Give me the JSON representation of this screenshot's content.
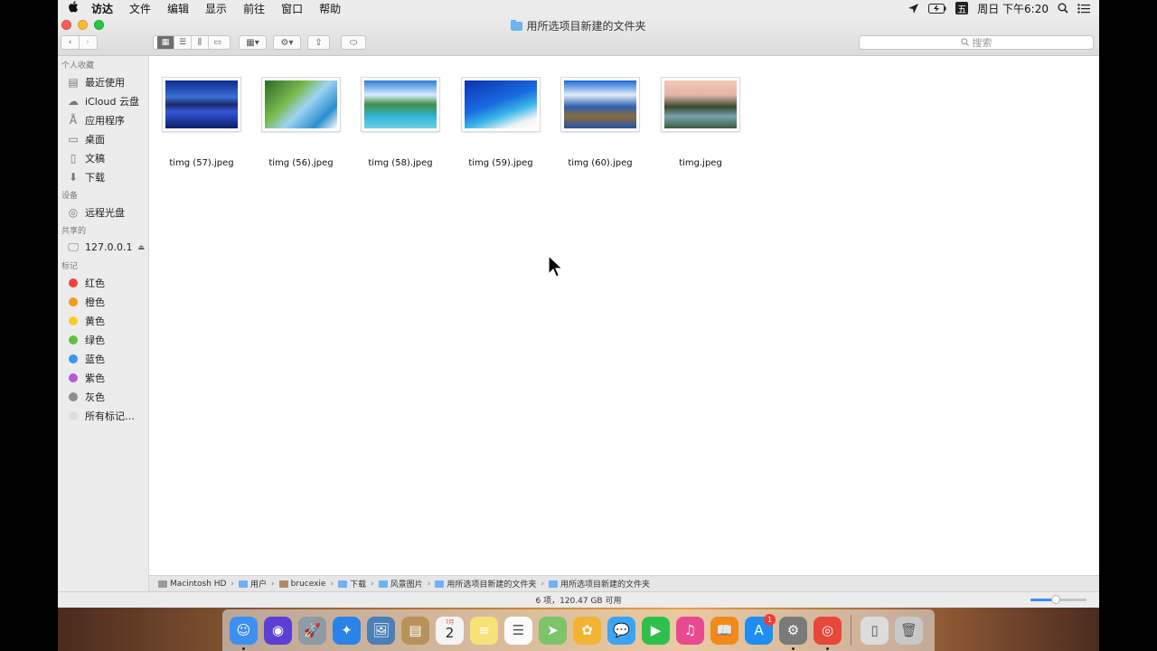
{
  "menubar": {
    "apple_icon": "apple-icon",
    "items": [
      "访达",
      "文件",
      "编辑",
      "显示",
      "前往",
      "窗口",
      "帮助"
    ],
    "ime_label": "五",
    "clock": "周日 下午6:20"
  },
  "window": {
    "title": "用所选项目新建的文件夹",
    "search_placeholder": "搜索"
  },
  "sidebar": {
    "sections": {
      "favorites": "个人收藏",
      "devices": "设备",
      "shared": "共享的",
      "tags": "标记"
    },
    "favorites": [
      {
        "label": "最近使用",
        "icon": "clock-doc-icon"
      },
      {
        "label": "iCloud 云盘",
        "icon": "cloud-icon"
      },
      {
        "label": "应用程序",
        "icon": "applications-icon"
      },
      {
        "label": "桌面",
        "icon": "desktop-icon"
      },
      {
        "label": "文稿",
        "icon": "document-icon"
      },
      {
        "label": "下载",
        "icon": "download-icon"
      }
    ],
    "devices": [
      {
        "label": "远程光盘",
        "icon": "disc-icon"
      }
    ],
    "shared": [
      {
        "label": "127.0.0.1",
        "icon": "monitor-icon"
      }
    ],
    "tags": [
      {
        "label": "红色",
        "color": "#f2413b"
      },
      {
        "label": "橙色",
        "color": "#f59a1a"
      },
      {
        "label": "黄色",
        "color": "#f7cd22"
      },
      {
        "label": "绿色",
        "color": "#5dc43c"
      },
      {
        "label": "蓝色",
        "color": "#3a96f0"
      },
      {
        "label": "紫色",
        "color": "#b65bd2"
      },
      {
        "label": "灰色",
        "color": "#8e8e8e"
      },
      {
        "label": "所有标记…",
        "color": "#dedede"
      }
    ]
  },
  "files": [
    {
      "name": "timg (57).jpeg"
    },
    {
      "name": "timg (56).jpeg"
    },
    {
      "name": "timg (58).jpeg"
    },
    {
      "name": "timg (59).jpeg"
    },
    {
      "name": "timg (60).jpeg"
    },
    {
      "name": "timg.jpeg"
    }
  ],
  "pathbar": [
    "Macintosh HD",
    "用户",
    "brucexie",
    "下载",
    "风景图片",
    "用所选项目新建的文件夹",
    "用所选项目新建的文件夹"
  ],
  "status": {
    "text": "6 项，120.47 GB 可用",
    "icon_size_level": 0.45
  },
  "dock": {
    "apps": [
      {
        "name": "finder-icon",
        "color": "#3d8ff0",
        "running": true
      },
      {
        "name": "siri-icon",
        "color": "#5b3fd4",
        "running": false
      },
      {
        "name": "launchpad-icon",
        "color": "#8f9aa7",
        "running": false
      },
      {
        "name": "safari-icon",
        "color": "#2a83e8",
        "running": false
      },
      {
        "name": "preview-icon",
        "color": "#4b7fb8",
        "running": false
      },
      {
        "name": "contacts-icon",
        "color": "#b9925b",
        "running": false
      },
      {
        "name": "calendar-icon",
        "color": "#f4f4f4",
        "running": false
      },
      {
        "name": "notes-icon",
        "color": "#f7e27a",
        "running": false
      },
      {
        "name": "reminders-icon",
        "color": "#fafafa",
        "running": false
      },
      {
        "name": "maps-icon",
        "color": "#7cc46a",
        "running": false
      },
      {
        "name": "photos-icon",
        "color": "#f3b432",
        "running": false
      },
      {
        "name": "messages-icon",
        "color": "#3aa4f5",
        "running": false
      },
      {
        "name": "facetime-icon",
        "color": "#2fc04b",
        "running": false
      },
      {
        "name": "itunes-icon",
        "color": "#e94a8f",
        "running": false
      },
      {
        "name": "ibooks-icon",
        "color": "#f28a1a",
        "running": false
      },
      {
        "name": "appstore-icon",
        "color": "#1e8ef5",
        "running": false,
        "badge": "1"
      },
      {
        "name": "system-preferences-icon",
        "color": "#7a7a7a",
        "running": true
      },
      {
        "name": "chrome-icon",
        "color": "#e8473a",
        "running": true
      }
    ],
    "calendar_month": "7月",
    "calendar_day": "2",
    "trailing": [
      {
        "name": "downloads-stack-icon",
        "color": "#dcdcdc"
      },
      {
        "name": "trash-icon",
        "color": "#c8c8c8"
      }
    ]
  }
}
